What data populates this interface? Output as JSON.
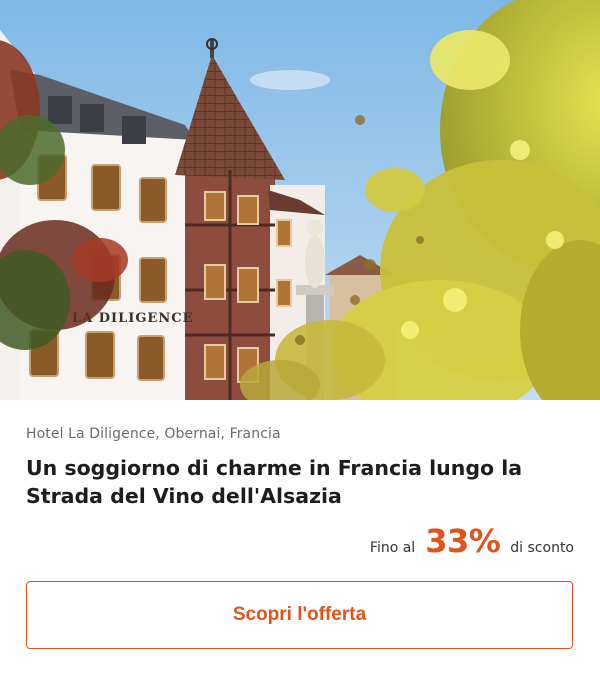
{
  "offer": {
    "location": "Hotel La Diligence, Obernai, Francia",
    "title": "Un soggiorno di charme in Francia lungo la Strada del Vino dell'Alsazia",
    "discount_prefix": "Fino al",
    "discount_value": "33%",
    "discount_suffix": "di sconto",
    "cta_label": "Scopri l'offerta"
  },
  "image": {
    "sign_text": "LA DILIGENCE"
  },
  "colors": {
    "accent": "#e0541b",
    "title": "#1d1d1d",
    "muted": "#6b6b6b"
  }
}
